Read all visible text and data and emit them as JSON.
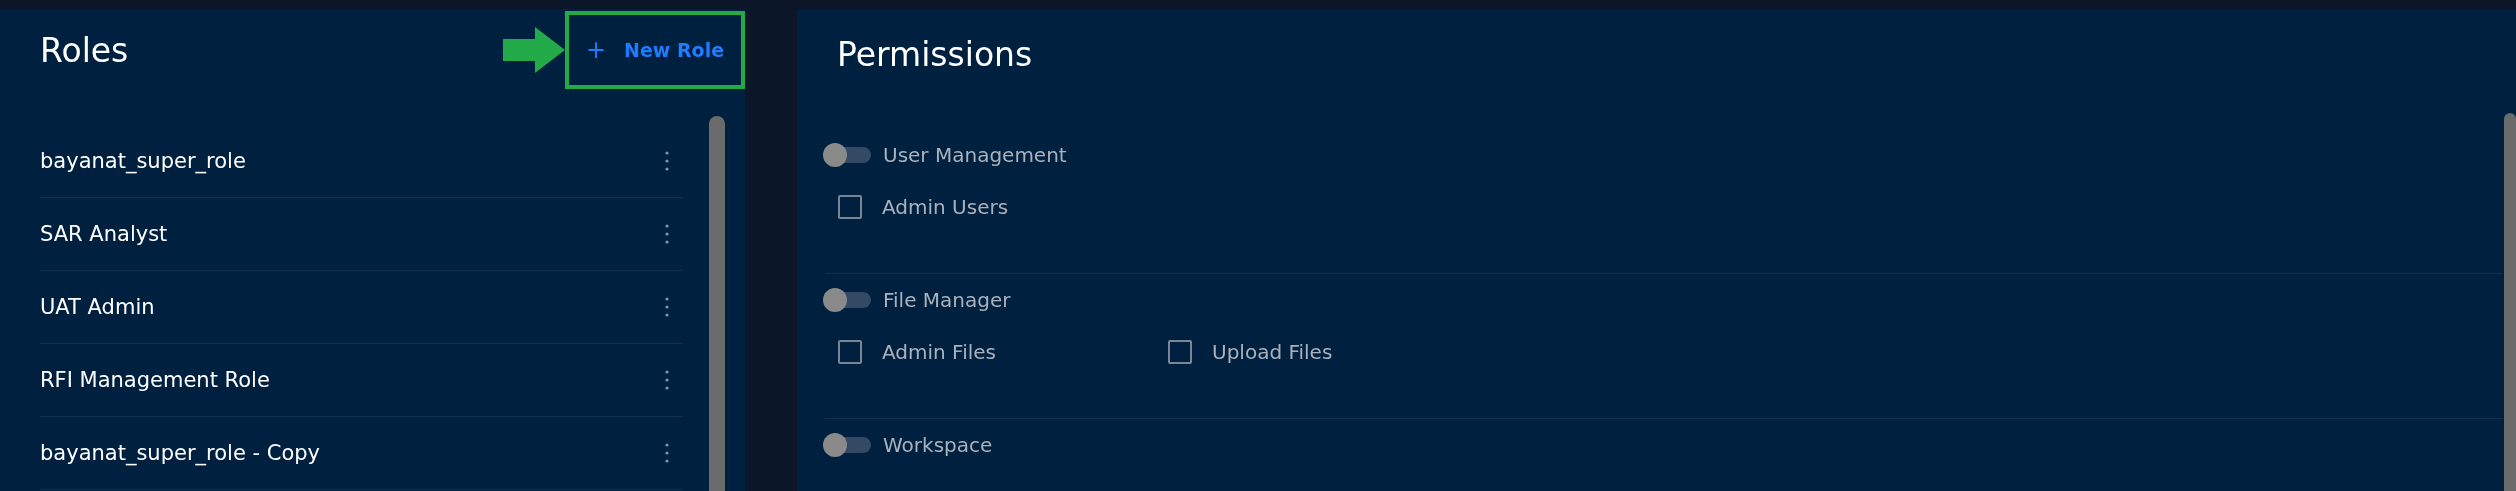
{
  "roles_panel": {
    "title": "Roles",
    "new_button": {
      "icon": "+",
      "label": "New Role"
    },
    "items": [
      {
        "name": "bayanat_super_role"
      },
      {
        "name": "SAR Analyst"
      },
      {
        "name": "UAT Admin"
      },
      {
        "name": "RFI Management Role"
      },
      {
        "name": "bayanat_super_role - Copy"
      }
    ]
  },
  "permissions_panel": {
    "title": "Permissions",
    "groups": [
      {
        "name": "User Management",
        "on": false,
        "items": [
          {
            "label": "Admin Users",
            "checked": false
          }
        ]
      },
      {
        "name": "File Manager",
        "on": false,
        "items": [
          {
            "label": "Admin Files",
            "checked": false
          },
          {
            "label": "Upload Files",
            "checked": false
          }
        ]
      },
      {
        "name": "Workspace",
        "on": false
      }
    ]
  }
}
